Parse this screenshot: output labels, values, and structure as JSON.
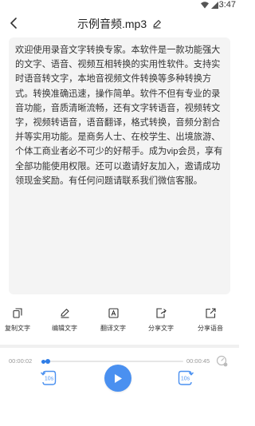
{
  "status_bar": {
    "time": "3:47"
  },
  "header": {
    "title": "示例音频.mp3"
  },
  "transcript": {
    "text": "欢迎使用录音文字转换专家。本软件是一款功能强大的文字、语音、视频互相转换的实用性软件。支持实时语音转文字，本地音视频文件转换等多种转换方式。转换准确迅速，操作简单。软件不但有专业的录音功能，音质清晰流畅，还有文字转语音，视频转文字，视频转语音，语音翻译，格式转换，音频分割合并等实用功能。是商务人士、在校学生、出境旅游、个体工商业者必不可少的好帮手。成为vip会员，享有全部功能使用权限。还可以邀请好友加入，邀请成功领现金奖励。有任何问题请联系我们微信客服。"
  },
  "toolbar": {
    "copy_label": "复制文字",
    "edit_label": "编辑文字",
    "translate_label": "翻译文字",
    "share_text_label": "分享文字",
    "share_audio_label": "分享语音"
  },
  "player": {
    "current_time": "00:00:02",
    "total_time": "00:00:45",
    "progress_fraction": 0.044,
    "rewind_label": "10s",
    "forward_label": "10s"
  },
  "colors": {
    "accent": "#4a90f0",
    "card_bg": "#f4f4f4"
  },
  "icons": [
    "back-arrow-icon",
    "pencil-icon",
    "copy-icon",
    "translate-icon",
    "share-icon",
    "speed-icon",
    "play-icon"
  ]
}
